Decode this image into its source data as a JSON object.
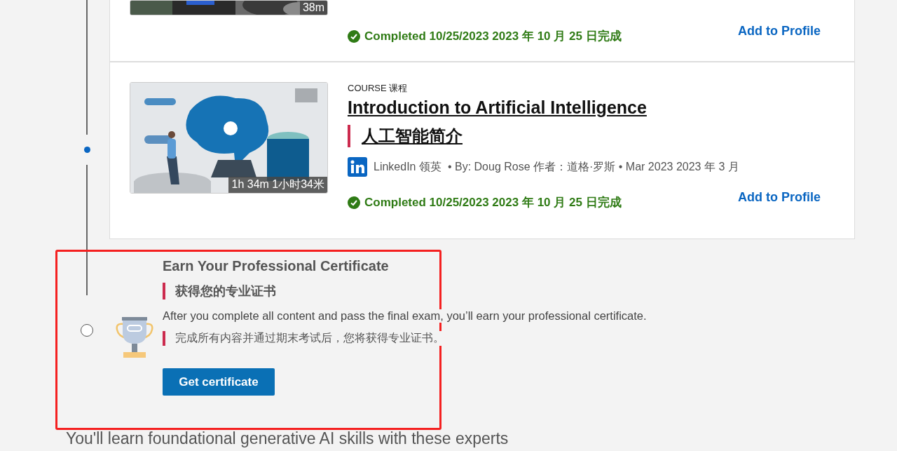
{
  "courses": [
    {
      "kind": "partial",
      "duration": "38m",
      "completed": "Completed 10/25/2023 2023 年 10 月 25 日完成",
      "action": "Add to Profile"
    },
    {
      "kind": "full",
      "step_done": true,
      "type_label": "COURSE 课程",
      "title": "Introduction to Artificial Intelligence",
      "title_translation": "人工智能简介",
      "provider": "LinkedIn 领英",
      "meta": "•  By: Doug Rose 作者：道格·罗斯  •  Mar 2023 2023 年 3 月",
      "duration": "1h 34m  1小时34米",
      "completed": "Completed 10/25/2023 2023 年 10 月 25 日完成",
      "action": "Add to Profile"
    }
  ],
  "certificate": {
    "step_done": false,
    "highlighted": true,
    "title": "Earn Your Professional Certificate",
    "title_translation": "获得您的专业证书",
    "description": "After you complete all content and pass the final exam, you’ll earn your professional certificate.",
    "description_translation": "完成所有内容并通过期末考试后，您将获得专业证书。",
    "button": "Get certificate"
  },
  "experts_heading": "You'll learn foundational generative AI skills with these experts"
}
